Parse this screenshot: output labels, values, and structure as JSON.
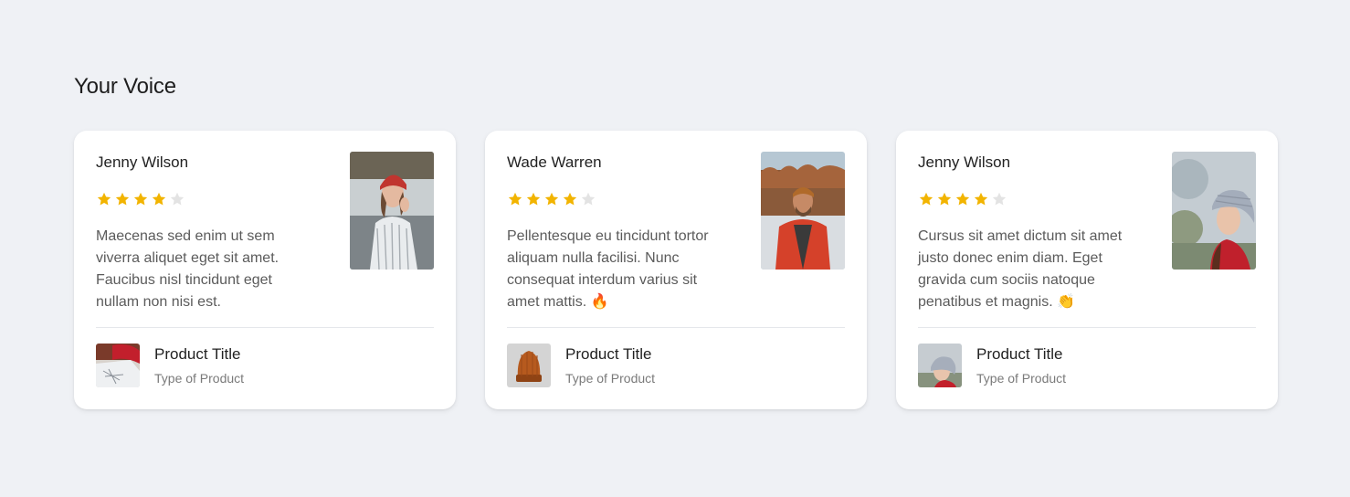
{
  "section": {
    "title": "Your Voice"
  },
  "colors": {
    "page_background": "#eff1f5",
    "card_background": "#ffffff",
    "star_filled": "#f2b400",
    "star_empty": "#e3e3e3"
  },
  "reviews": [
    {
      "reviewer_name": "Jenny Wilson",
      "rating": 4,
      "max_rating": 5,
      "text": "Maecenas sed enim ut sem viverra aliquet eget sit amet. Faucibus nisl tincidunt eget nullam non nisi est.",
      "emoji": "",
      "product_title": "Product Title",
      "product_type": "Type of Product"
    },
    {
      "reviewer_name": "Wade Warren",
      "rating": 4,
      "max_rating": 5,
      "text": "Pellentesque eu tincidunt tortor aliquam nulla facilisi. Nunc consequat interdum varius sit amet mattis.",
      "emoji": "🔥",
      "product_title": "Product Title",
      "product_type": "Type of Product"
    },
    {
      "reviewer_name": "Jenny Wilson",
      "rating": 4,
      "max_rating": 5,
      "text": "Cursus sit amet dictum sit amet justo donec enim diam. Eget gravida cum sociis natoque penatibus et magnis.",
      "emoji": "👏",
      "product_title": "Product Title",
      "product_type": "Type of Product"
    }
  ]
}
